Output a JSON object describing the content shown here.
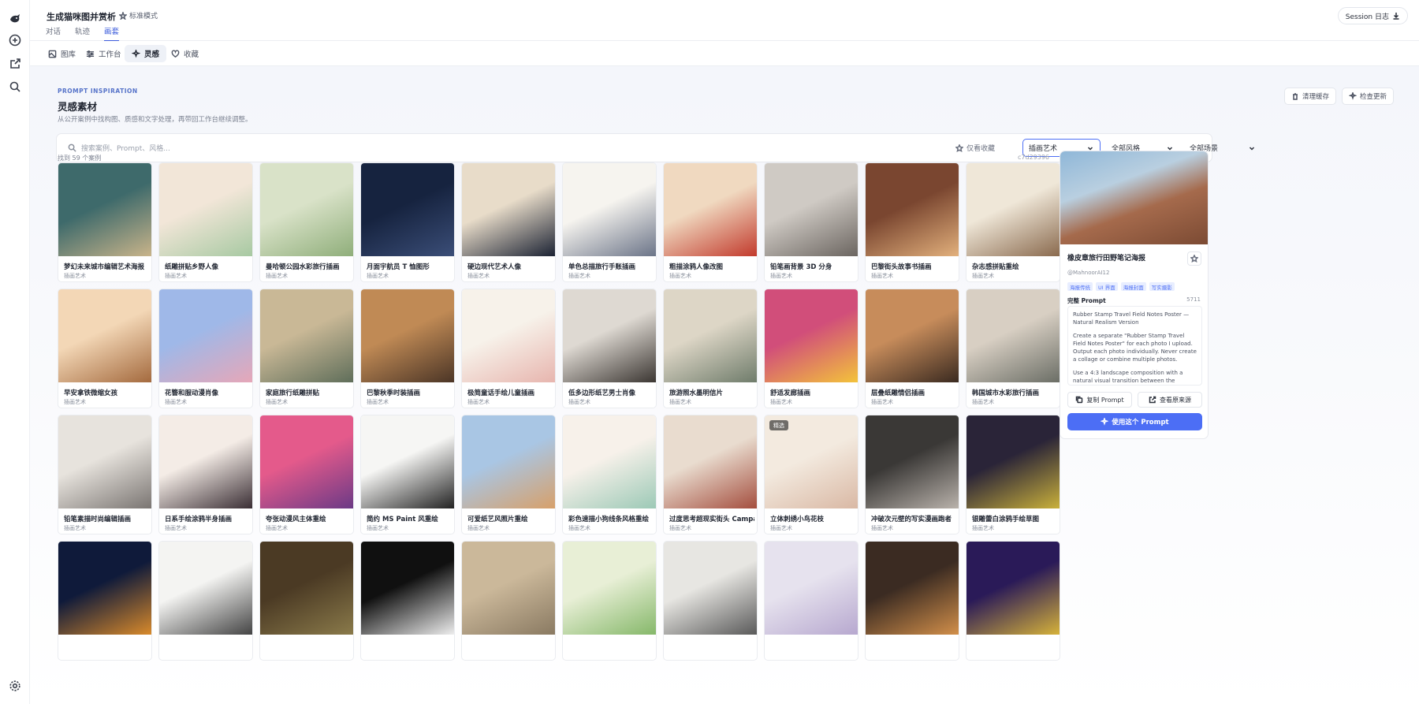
{
  "app": {
    "title": "生成猫咪图并赏析",
    "mode_label": "标准模式",
    "tabs": [
      "对话",
      "轨迹",
      "画套"
    ],
    "active_tab": 2,
    "session_button": "Session 日志"
  },
  "subnav": {
    "items": [
      {
        "label": "图库",
        "icon": "image-icon"
      },
      {
        "label": "工作台",
        "icon": "sliders-icon"
      },
      {
        "label": "灵感",
        "icon": "sparkles-icon"
      },
      {
        "label": "收藏",
        "icon": "heart-icon"
      }
    ],
    "active": 2
  },
  "header": {
    "kicker": "PROMPT INSPIRATION",
    "title": "灵感素材",
    "description": "从公开案例中找构图、质感和文字处理，再带回工作台继续调整。",
    "clear_cache": "清理缓存",
    "check_updates": "检查更新"
  },
  "filters": {
    "search_placeholder": "搜索案例、Prompt、风格...",
    "favorites_only": "仅看收藏",
    "category": "插画艺术",
    "style": "全部风格",
    "scene": "全部场景"
  },
  "results": {
    "count_text": "找到 59 个案例",
    "hash": "c7d29396"
  },
  "cards": [
    {
      "title": "梦幻未来城市编辑艺术海报",
      "category": "插画艺术"
    },
    {
      "title": "纸雕拼贴乡野人像",
      "category": "插画艺术"
    },
    {
      "title": "曼哈顿公园水彩旅行插画",
      "category": "插画艺术"
    },
    {
      "title": "月面宇航员 T 恤图形",
      "category": "插画艺术"
    },
    {
      "title": "硬边现代艺术人像",
      "category": "插画艺术"
    },
    {
      "title": "单色总描旅行手账插画",
      "category": "插画艺术"
    },
    {
      "title": "粗描涂鸦人像改图",
      "category": "插画艺术"
    },
    {
      "title": "铅笔画背景 3D 分身",
      "category": "插画艺术"
    },
    {
      "title": "巴黎街头故事书插画",
      "category": "插画艺术"
    },
    {
      "title": "杂志感拼贴重绘",
      "category": "插画艺术"
    },
    {
      "title": "早安拿铁微缩女孩",
      "category": "插画艺术"
    },
    {
      "title": "花簪和服动漫肖像",
      "category": "插画艺术"
    },
    {
      "title": "家庭旅行纸雕拼贴",
      "category": "插画艺术"
    },
    {
      "title": "巴黎秋季时装插画",
      "category": "插画艺术"
    },
    {
      "title": "极简童话手绘儿童插画",
      "category": "插画艺术"
    },
    {
      "title": "低多边形纸艺男士肖像",
      "category": "插画艺术"
    },
    {
      "title": "旅游照水墨明信片",
      "category": "插画艺术"
    },
    {
      "title": "舒适发廊插画",
      "category": "插画艺术"
    },
    {
      "title": "层叠纸雕情侣插画",
      "category": "插画艺术"
    },
    {
      "title": "韩国城市水彩旅行插画",
      "category": "插画艺术"
    },
    {
      "title": "铅笔素描时尚编辑插画",
      "category": "插画艺术"
    },
    {
      "title": "日系手绘涂鸦半身插画",
      "category": "插画艺术"
    },
    {
      "title": "夸张动漫风主体重绘",
      "category": "插画艺术"
    },
    {
      "title": "简约 MS Paint 风重绘",
      "category": "插画艺术"
    },
    {
      "title": "可爱纸艺风照片重绘",
      "category": "插画艺术"
    },
    {
      "title": "彩色速描小狗线条风格重绘",
      "category": "插画艺术"
    },
    {
      "title": "过度思考超现实街头 Campaign",
      "category": "插画艺术"
    },
    {
      "title": "立体刺绣小鸟花枝",
      "category": "插画艺术",
      "badge": "精选"
    },
    {
      "title": "冲破次元壁的写实漫画跑者",
      "category": "插画艺术"
    },
    {
      "title": "银雕蕾白涂鸦手绘草图",
      "category": "插画艺术"
    },
    {
      "title": "",
      "category": ""
    },
    {
      "title": "",
      "category": ""
    },
    {
      "title": "",
      "category": ""
    },
    {
      "title": "",
      "category": ""
    },
    {
      "title": "",
      "category": ""
    },
    {
      "title": "",
      "category": ""
    },
    {
      "title": "",
      "category": ""
    },
    {
      "title": "",
      "category": ""
    },
    {
      "title": "",
      "category": ""
    },
    {
      "title": "",
      "category": ""
    }
  ],
  "detail": {
    "title": "橡皮章旅行田野笔记海报",
    "author": "@MahnoorAI12",
    "tags": [
      "海报传统",
      "UI 界面",
      "海报封面",
      "写实摄影"
    ],
    "prompt_label": "完整 Prompt",
    "prompt_count": "5711",
    "prompt_paragraphs": [
      "Rubber Stamp Travel Field Notes Poster — Natural Realism Version",
      "Create a separate \"Rubber Stamp Travel Field Notes Poster\" for each photo I upload. Output each photo individually. Never create a collage or combine multiple photos.",
      "Use a 4:3 landscape composition with a natural visual transition between the original photograph"
    ],
    "copy_prompt": "复制 Prompt",
    "view_source": "查看原来源",
    "use_prompt": "使用这个 Prompt"
  },
  "colors": {
    "accent": "#4c6ef5",
    "kicker": "#5673c9"
  }
}
